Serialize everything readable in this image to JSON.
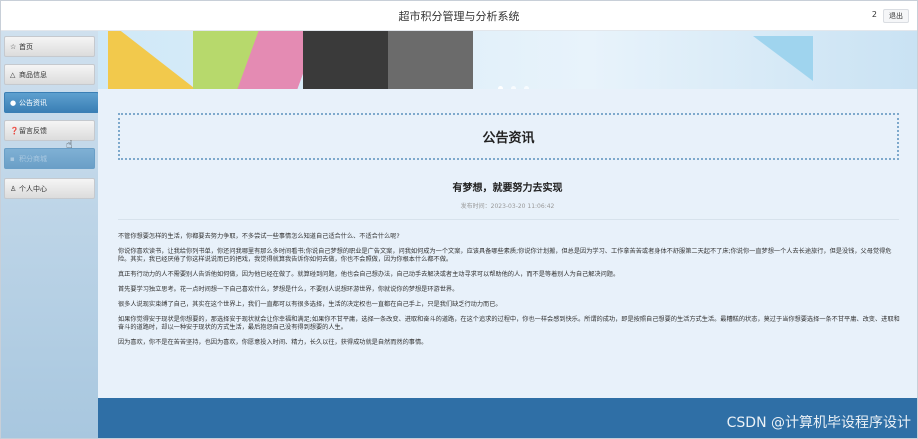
{
  "header": {
    "title": "超市积分管理与分析系统",
    "user": "2",
    "logout_label": "退出"
  },
  "sidebar": {
    "items": [
      {
        "label": "首页",
        "icon": "star-icon"
      },
      {
        "label": "商品信息",
        "icon": "bag-icon"
      },
      {
        "label": "公告资讯",
        "icon": "circle-icon"
      },
      {
        "label": "留言反馈",
        "icon": "help-icon"
      },
      {
        "label": "积分商城",
        "icon": "gift-icon"
      },
      {
        "label": "个人中心",
        "icon": "user-icon"
      }
    ]
  },
  "main": {
    "section_title": "公告资讯",
    "article_title": "有梦想，就要努力去实现",
    "meta": "发布时间：2023-03-20 11:06:42",
    "paragraphs": [
      "不管你想要怎样的生活，你都要去努力争取，不多尝试一些事情怎么知道自己适合什么、不适合什么呢?",
      "你说你喜欢读书，让我给你列书单，你还问我哪里有那么多时间看书;你说自己梦想的职业是广告文案，问我如何成为一个文案，应该具备哪些素质;你说你计划搬，但总是因为学习、工作拿苦苦或者身体不舒服第二天起不了床;你说你一直梦想一个人去长途旅行，但是没钱，父母觉得危险。其实，我已经厌倦了你这样说说而已的把戏，我觉得就算我告诉你如何去做，你也不会照做，因为你根本什么都不做。",
      "真正有行动力的人不需要别人告诉他如何做，因为他已经在做了。就算碰到问题，他也会自己想办法，自己动手去解决或者主动寻求可以帮助他的人，而不是等着别人为自己解决问题。",
      "首先要学习独立思考。花一点时间想一下自己喜欢什么，梦想是什么，不要别人说想环游世界，你就说你的梦想是环游世界。",
      "很多人说现实束缚了自己，其实在这个世界上，我们一直都可以有很多选择，生活的决定权也一直都在自己手上，只是我们缺乏行动力而已。",
      "如果你觉得安于现状是你想要的，那选择安于现状就会让你幸福和满足;如果你不甘平庸，选择一条改变、进取和奋斗的道路，在这个追求的过程中，你也一样会感到快乐。所谓的成功，即是按照自己想要的生活方式生活。最糟糕的状态，莫过于当你想要选择一条不甘平庸、改变、进取和奋斗的道路时，却以一种安于现状的方式生活，最后抱怨自己没有得到想要的人生。",
      "因为喜欢，你不是在苦苦坚持，也因为喜欢，你愿意投入时间、精力，长久以往，获得成功就是自然而然的事情。"
    ]
  },
  "watermark": "CSDN @计算机毕设程序设计",
  "colors": {
    "accent": "#3a7fb5",
    "footer": "#2f6fa6",
    "title_border": "#7ea9cc"
  }
}
